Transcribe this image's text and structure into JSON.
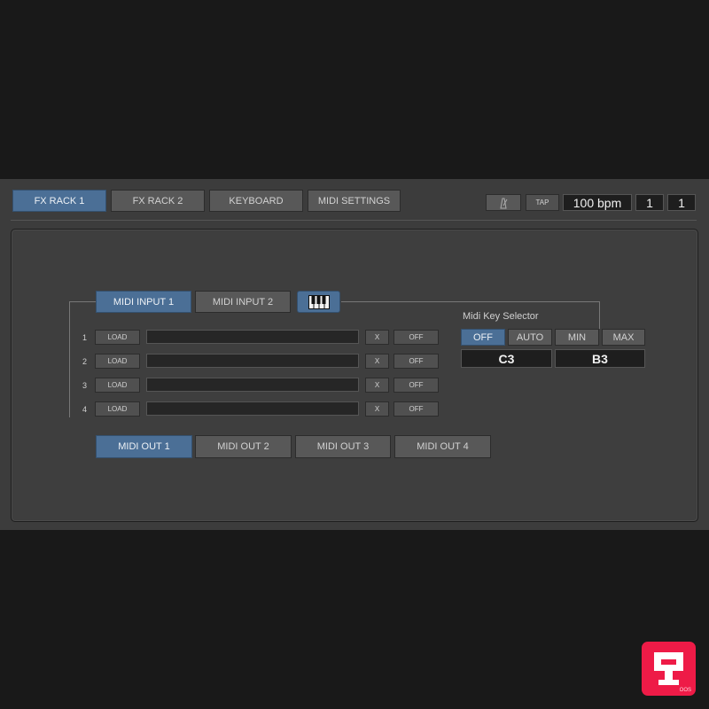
{
  "header": {
    "tabs": [
      {
        "label": "FX RACK 1",
        "active": true
      },
      {
        "label": "FX RACK 2",
        "active": false
      },
      {
        "label": "KEYBOARD",
        "active": false
      },
      {
        "label": "MIDI SETTINGS",
        "active": false
      }
    ],
    "transport": {
      "metronome_icon": "metronome-icon",
      "tap_label": "TAP",
      "bpm": "100 bpm",
      "signature_top": "1",
      "signature_bottom": "1"
    }
  },
  "midi_inputs": {
    "tabs": [
      {
        "label": "MIDI INPUT 1",
        "active": true
      },
      {
        "label": "MIDI INPUT 2",
        "active": false
      }
    ],
    "keyboard_icon": "piano-keyboard-icon",
    "slots": [
      {
        "number": "1",
        "load_label": "LOAD",
        "value": "",
        "clear_label": "X",
        "toggle_label": "OFF"
      },
      {
        "number": "2",
        "load_label": "LOAD",
        "value": "",
        "clear_label": "X",
        "toggle_label": "OFF"
      },
      {
        "number": "3",
        "load_label": "LOAD",
        "value": "",
        "clear_label": "X",
        "toggle_label": "OFF"
      },
      {
        "number": "4",
        "load_label": "LOAD",
        "value": "",
        "clear_label": "X",
        "toggle_label": "OFF"
      }
    ]
  },
  "key_selector": {
    "title": "Midi Key Selector",
    "modes": [
      {
        "label": "OFF",
        "active": true
      },
      {
        "label": "AUTO",
        "active": false
      },
      {
        "label": "MIN",
        "active": false
      },
      {
        "label": "MAX",
        "active": false
      }
    ],
    "low_key": "C3",
    "high_key": "B3"
  },
  "midi_outputs": {
    "tabs": [
      {
        "label": "MIDI OUT 1",
        "active": true
      },
      {
        "label": "MIDI OUT 2",
        "active": false
      },
      {
        "label": "MIDI OUT 3",
        "active": false
      },
      {
        "label": "MIDI OUT 4",
        "active": false
      }
    ]
  },
  "branding": {
    "logo_icon": "brand-logo-icon",
    "logo_subtext": "OOS"
  },
  "colors": {
    "accent": "#4b6f96",
    "background": "#3c3c3c",
    "logo": "#ee1b47"
  }
}
